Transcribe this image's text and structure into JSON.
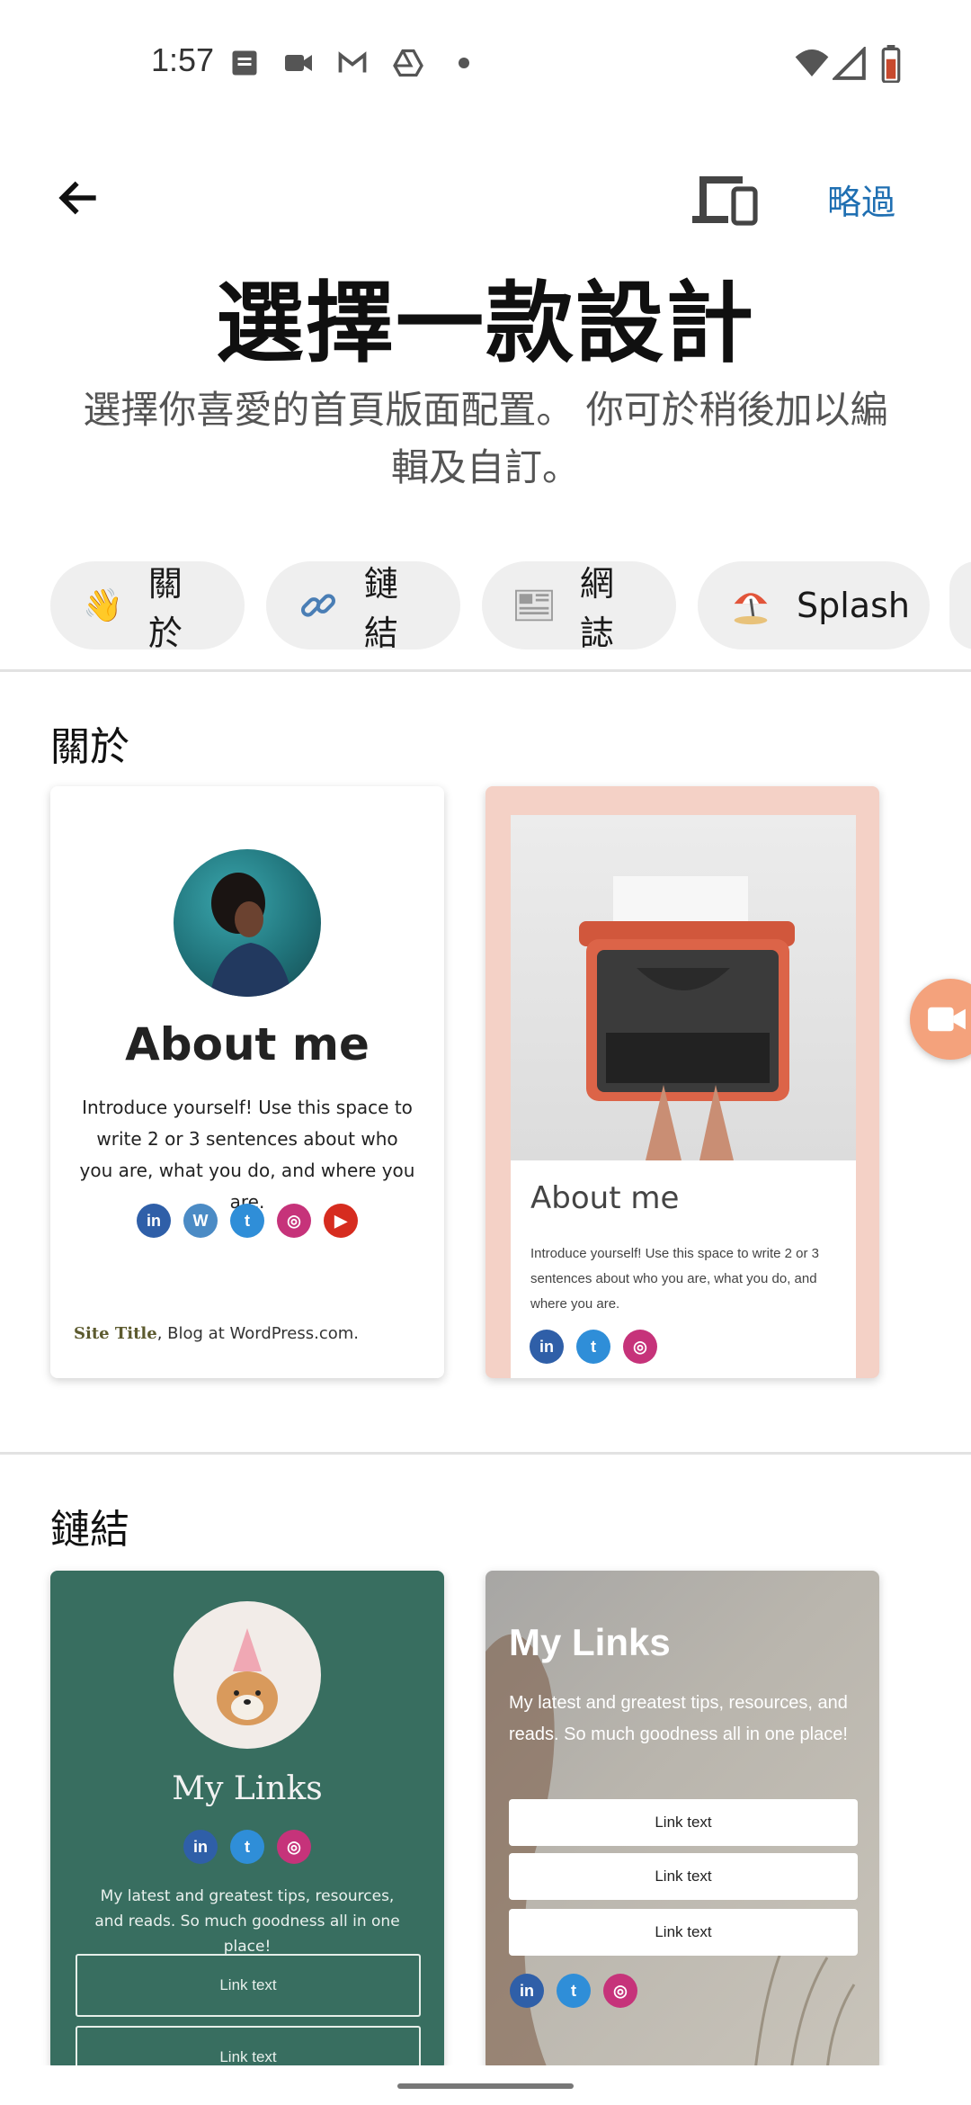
{
  "status_bar": {
    "time": "1:57"
  },
  "header": {
    "skip_label": "略過",
    "title": "選擇一款設計",
    "subtitle": "選擇你喜愛的首頁版面配置。 你可於稍後加以編輯及自訂。"
  },
  "chips": [
    {
      "emoji": "👋",
      "label": "關於"
    },
    {
      "emoji": "🔗",
      "label": "鏈結"
    },
    {
      "emoji": "📰",
      "label": "網誌"
    },
    {
      "emoji": "⛱️",
      "label": "Splash"
    }
  ],
  "sections": {
    "about": {
      "title": "關於",
      "card1": {
        "heading": "About me",
        "body": "Introduce yourself! Use this space to write 2 or 3 sentences about who you are, what you do, and where you are.",
        "footer_site": "Site Title",
        "footer_rest": ", Blog at WordPress.com."
      },
      "card2": {
        "heading": "About me",
        "body": "Introduce yourself! Use this space to write 2 or 3 sentences about who you are, what you do, and where you are."
      }
    },
    "links": {
      "title": "鏈結",
      "card1": {
        "heading": "My Links",
        "body": "My latest and greatest tips, resources, and reads. So much goodness all in one place!",
        "buttons": [
          "Link text",
          "Link text"
        ]
      },
      "card2": {
        "heading": "My Links",
        "body": "My latest and greatest tips, resources, and reads. So much goodness all in one place!",
        "buttons": [
          "Link text",
          "Link text",
          "Link text"
        ]
      }
    }
  },
  "social": {
    "linkedin": "in",
    "wordpress": "W",
    "twitter": "t",
    "instagram": "◎",
    "youtube": "▶"
  },
  "colors": {
    "accent": "#1f6fb2",
    "links_card_green": "#386e60",
    "about_card_pink": "#f4d1c6"
  }
}
